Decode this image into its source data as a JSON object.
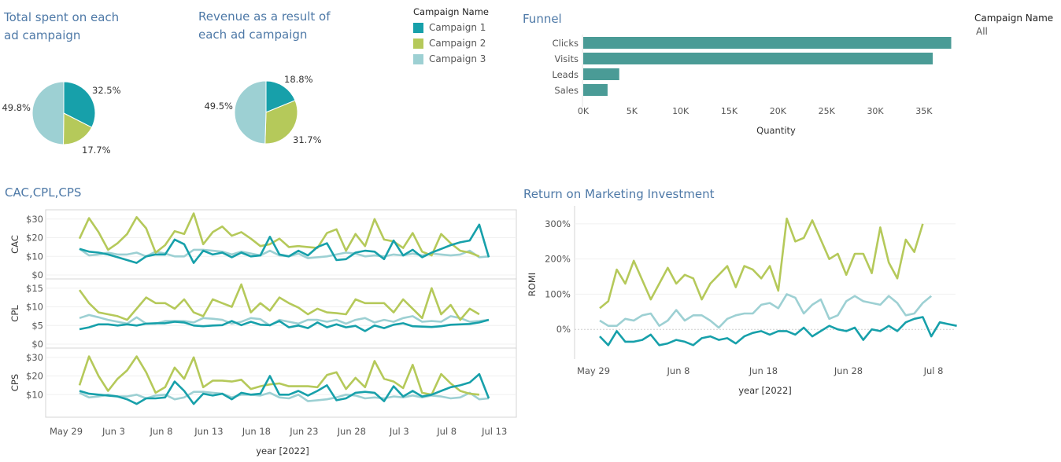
{
  "colors": {
    "c1": "#17a0aa",
    "c2": "#b5c95a",
    "c3": "#9dd0d3",
    "funnel": "#4a9b96",
    "title": "#4e79a7"
  },
  "pie_spent": {
    "title_line1": "Total spent on each",
    "title_line2": "ad campaign",
    "labels": [
      "32.5%",
      "17.7%",
      "49.8%"
    ]
  },
  "pie_revenue": {
    "title_line1": "Revenue as a result of",
    "title_line2": "each ad campaign",
    "labels": [
      "18.8%",
      "31.7%",
      "49.5%"
    ]
  },
  "legend": {
    "title": "Campaign Name",
    "items": [
      "Campaign 1",
      "Campaign 2",
      "Campaign 3"
    ]
  },
  "filter": {
    "title": "Campaign Name",
    "value": "All"
  },
  "funnel": {
    "title": "Funnel",
    "xlabel": "Quantity"
  },
  "cac": {
    "title": "CAC,CPL,CPS",
    "xlabel": "year [2022]"
  },
  "romi": {
    "title": "Return on Marketing Investment",
    "xlabel": "year [2022]",
    "ylabel": "ROMI"
  },
  "chart_data": [
    {
      "type": "pie",
      "title": "Total spent on each ad campaign",
      "categories": [
        "Campaign 1",
        "Campaign 2",
        "Campaign 3"
      ],
      "values": [
        32.5,
        17.7,
        49.8
      ]
    },
    {
      "type": "pie",
      "title": "Revenue as a result of each ad campaign",
      "categories": [
        "Campaign 1",
        "Campaign 2",
        "Campaign 3"
      ],
      "values": [
        18.8,
        31.7,
        49.5
      ]
    },
    {
      "type": "bar",
      "orientation": "horizontal",
      "title": "Funnel",
      "categories": [
        "Clicks",
        "Visits",
        "Leads",
        "Sales"
      ],
      "values": [
        37800,
        35900,
        3700,
        2500
      ],
      "xlabel": "Quantity",
      "xlim": [
        0,
        38000
      ],
      "xticks": [
        "0K",
        "5K",
        "10K",
        "15K",
        "20K",
        "25K",
        "30K",
        "35K"
      ],
      "xtick_values": [
        0,
        5000,
        10000,
        15000,
        20000,
        25000,
        30000,
        35000
      ]
    },
    {
      "type": "line",
      "title": "CAC,CPL,CPS",
      "xlabel": "year [2022]",
      "x_start": "May 29",
      "x_count": 44,
      "xticks": [
        "May 29",
        "Jun 3",
        "Jun 8",
        "Jun 13",
        "Jun 18",
        "Jun 23",
        "Jun 28",
        "Jul 3",
        "Jul 8",
        "Jul 13"
      ],
      "xtick_day_index": [
        0,
        5,
        10,
        15,
        20,
        25,
        30,
        35,
        40,
        45
      ],
      "panels": [
        {
          "ylabel": "CAC",
          "ylim": [
            0,
            32
          ],
          "yticks": [
            "$0",
            "$10",
            "$20",
            "$30"
          ],
          "ytick_values": [
            0,
            10,
            20,
            30
          ],
          "series": [
            {
              "name": "Campaign 1",
              "values": [
                14,
                12.5,
                12,
                11,
                9.5,
                8,
                6.5,
                10,
                11,
                11,
                19,
                16.5,
                6.5,
                13,
                11,
                12,
                9.5,
                12,
                10,
                10.5,
                20.5,
                11,
                10,
                13,
                10.5,
                15,
                17,
                8,
                8.5,
                12,
                13,
                12.5,
                8.5,
                18.5,
                10.5,
                13.5,
                9.5,
                12,
                14,
                16,
                17.5,
                18.5,
                27,
                9.5
              ]
            },
            {
              "name": "Campaign 2",
              "values": [
                19.5,
                30.5,
                23,
                13.5,
                17,
                22,
                31,
                25,
                12,
                16,
                23.5,
                22,
                33,
                16.5,
                23,
                26,
                21,
                23,
                19.5,
                15.5,
                16.5,
                19.5,
                15,
                15.5,
                15,
                14.5,
                22.5,
                24.5,
                13,
                22,
                15.5,
                30,
                19,
                18,
                14.5,
                22.5,
                12.5,
                10.5,
                22,
                17,
                13,
                12,
                10
              ]
            },
            {
              "name": "Campaign 3",
              "values": [
                14,
                10.5,
                11,
                12,
                11,
                11,
                12,
                10,
                12.5,
                11.5,
                10,
                10,
                13.5,
                13.5,
                13,
                12.5,
                11,
                12.5,
                11.5,
                10.5,
                13,
                10.5,
                10,
                11.5,
                9,
                9.5,
                10,
                11,
                12,
                11.5,
                10,
                10.5,
                10,
                11,
                10.5,
                11.5,
                10.5,
                11.5,
                11,
                10.5,
                11,
                13,
                9.5,
                10
              ]
            }
          ]
        },
        {
          "ylabel": "CPL",
          "ylim": [
            0,
            16
          ],
          "yticks": [
            "$0",
            "$5",
            "$10",
            "$15"
          ],
          "ytick_values": [
            0,
            5,
            10,
            15
          ],
          "series": [
            {
              "name": "Campaign 1",
              "values": [
                4,
                4.5,
                5.3,
                5.3,
                5,
                5.3,
                5,
                5.5,
                5.6,
                5.6,
                6,
                5.8,
                5,
                4.8,
                5,
                5.1,
                6.2,
                5.1,
                6,
                5.2,
                5.1,
                6.2,
                4.5,
                5,
                4.3,
                5.8,
                4.5,
                5.3,
                4.5,
                4.9,
                3.5,
                5,
                4.3,
                5.2,
                5.6,
                4.8,
                4.7,
                4.6,
                4.8,
                5.2,
                5.3,
                5.4,
                5.8,
                6.5
              ]
            },
            {
              "name": "Campaign 2",
              "values": [
                14.5,
                11,
                8.5,
                8,
                7.5,
                6.5,
                9.5,
                12.5,
                11,
                11,
                9.5,
                12,
                8.5,
                7.5,
                12,
                11,
                10,
                16,
                8.5,
                11,
                9,
                12.5,
                11,
                9.8,
                8,
                9.5,
                8.5,
                8.3,
                8,
                12,
                11,
                11,
                11,
                8.5,
                12,
                9.5,
                7,
                15,
                8,
                10.5,
                6.5,
                9.5,
                8
              ]
            },
            {
              "name": "Campaign 3",
              "values": [
                7,
                7.8,
                7.2,
                6.5,
                6,
                5.5,
                7.2,
                5.5,
                5.5,
                6.2,
                6.2,
                6.2,
                5.8,
                7,
                6.8,
                6.5,
                5.5,
                6,
                7,
                6.7,
                5,
                6.5,
                6,
                5.5,
                6.5,
                6.5,
                6,
                6.5,
                5.5,
                6.5,
                7,
                5.8,
                6.5,
                6,
                7,
                7.5,
                6,
                6.2,
                6,
                7.5,
                7,
                6,
                6.2,
                6.5
              ]
            }
          ]
        },
        {
          "ylabel": "CPS",
          "ylim": [
            0,
            32
          ],
          "yticks": [
            "$10",
            "$20",
            "$30"
          ],
          "ytick_values": [
            10,
            20,
            30
          ],
          "series": [
            {
              "name": "Campaign 1",
              "values": [
                12,
                10.5,
                10,
                9.5,
                9,
                7.5,
                5,
                8,
                8,
                8.5,
                17,
                12,
                5,
                10.5,
                9.5,
                10.5,
                7.5,
                11,
                10,
                10.5,
                20,
                10,
                10,
                12,
                9.5,
                12,
                15,
                7,
                8,
                11,
                11.5,
                11,
                6.5,
                14.5,
                9,
                12,
                9,
                10,
                12,
                14,
                15,
                16.5,
                21,
                8
              ]
            },
            {
              "name": "Campaign 2",
              "values": [
                15,
                30.5,
                20,
                12,
                18.5,
                23,
                30.5,
                22,
                11,
                14,
                24.5,
                18.5,
                30,
                14,
                17.5,
                17.5,
                17,
                18,
                13,
                14.5,
                15.5,
                16,
                14.5,
                14.5,
                14.5,
                14,
                20.5,
                22,
                13,
                19,
                14,
                28,
                18.5,
                17,
                13.5,
                26,
                11,
                10,
                21,
                16,
                12,
                10.5,
                10
              ]
            },
            {
              "name": "Campaign 3",
              "values": [
                11,
                8.5,
                9,
                10,
                9,
                9,
                10,
                8,
                9.5,
                10,
                7.5,
                8.5,
                11.5,
                11.5,
                11,
                10.5,
                8.5,
                10,
                10,
                9.5,
                11,
                8.5,
                8,
                10,
                6.5,
                7,
                7.5,
                8.5,
                10,
                9.5,
                8,
                8.5,
                8,
                9,
                8.5,
                9.5,
                8.5,
                9.5,
                9,
                8,
                8.5,
                11,
                7.5,
                8
              ]
            }
          ]
        }
      ]
    },
    {
      "type": "line",
      "title": "Return on Marketing Investment",
      "xlabel": "year [2022]",
      "ylabel": "ROMI",
      "x_start": "May 29",
      "x_count": 44,
      "xticks": [
        "May 29",
        "Jun 8",
        "Jun 18",
        "Jun 28",
        "Jul 8"
      ],
      "xtick_day_index": [
        0,
        10,
        20,
        30,
        40
      ],
      "ylim": [
        -80,
        340
      ],
      "yticks": [
        "0%",
        "100%",
        "200%",
        "300%"
      ],
      "ytick_values": [
        0,
        100,
        200,
        300
      ],
      "series": [
        {
          "name": "Campaign 1",
          "values": [
            -20,
            -45,
            -5,
            -35,
            -35,
            -30,
            -15,
            -45,
            -40,
            -30,
            -35,
            -45,
            -25,
            -20,
            -30,
            -25,
            -40,
            -20,
            -10,
            -5,
            -15,
            -5,
            -5,
            -15,
            5,
            -20,
            -5,
            10,
            0,
            -5,
            5,
            -30,
            0,
            -5,
            10,
            -5,
            20,
            30,
            35,
            -20,
            20,
            15,
            10
          ]
        },
        {
          "name": "Campaign 2",
          "values": [
            60,
            80,
            170,
            130,
            195,
            140,
            85,
            130,
            175,
            130,
            155,
            145,
            85,
            130,
            155,
            180,
            120,
            180,
            170,
            145,
            180,
            110,
            315,
            250,
            260,
            310,
            255,
            200,
            215,
            155,
            215,
            215,
            160,
            290,
            190,
            145,
            255,
            220,
            300
          ]
        },
        {
          "name": "Campaign 3",
          "values": [
            25,
            10,
            10,
            30,
            25,
            40,
            45,
            10,
            25,
            55,
            25,
            40,
            40,
            25,
            5,
            30,
            40,
            45,
            45,
            70,
            75,
            60,
            100,
            90,
            45,
            70,
            85,
            30,
            40,
            80,
            95,
            80,
            75,
            70,
            95,
            75,
            40,
            45,
            75,
            95
          ]
        }
      ]
    }
  ]
}
